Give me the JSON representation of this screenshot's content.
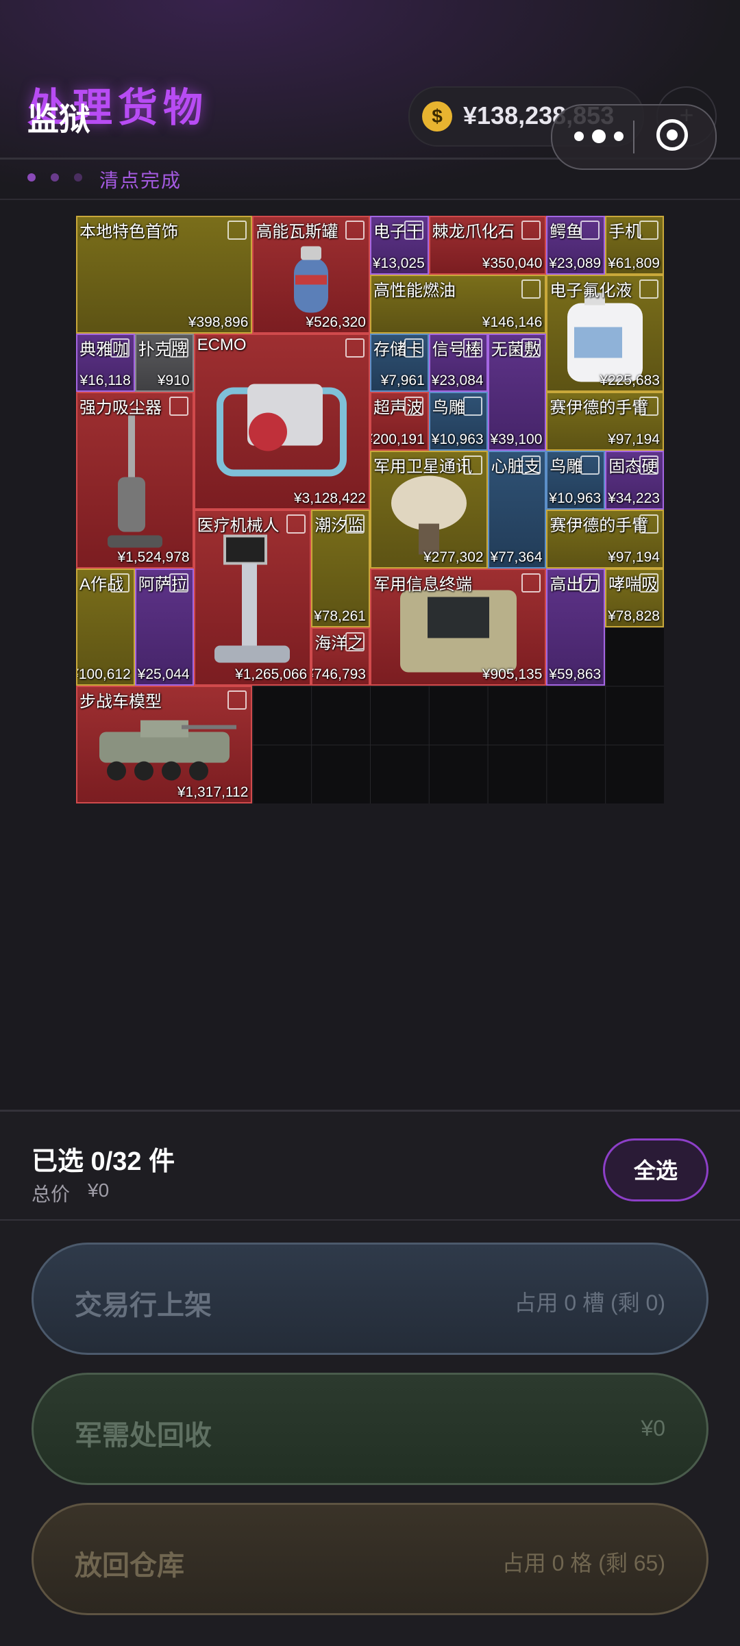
{
  "header": {
    "title": "处理货物",
    "overlay_title": "监狱",
    "currency_symbol": "$",
    "balance": "¥138,238,853",
    "plus": "+",
    "status": "清点完成"
  },
  "colors": {
    "accent": "#b84cf4",
    "rarity_red": "#9e2f31",
    "rarity_gold": "#7a6e1a",
    "rarity_purple": "#5e3389",
    "rarity_blue": "#2f5275",
    "rarity_gray": "#5b5b5e"
  },
  "inventory": {
    "columns": 10,
    "rows": 10,
    "items": [
      {
        "name": "本地特色首饰",
        "price": "¥398,896",
        "rarity": "gold",
        "icon": "jewelry-icon"
      },
      {
        "name": "高能瓦斯罐",
        "price": "¥526,320",
        "rarity": "red",
        "icon": "gas-tank-icon"
      },
      {
        "name": "电子干",
        "price": "¥13,025",
        "rarity": "purple",
        "icon": "electronics-icon"
      },
      {
        "name": "棘龙爪化石",
        "price": "¥350,040",
        "rarity": "red",
        "icon": "fossil-icon"
      },
      {
        "name": "鳄鱼",
        "price": "¥23,089",
        "rarity": "purple",
        "icon": "crocodile-icon"
      },
      {
        "name": "手机",
        "price": "¥61,809",
        "rarity": "gold",
        "icon": "phone-icon"
      },
      {
        "name": "高性能燃油",
        "price": "¥146,146",
        "rarity": "gold",
        "icon": "fuel-icon"
      },
      {
        "name": "电子氟化液",
        "price": "¥225,683",
        "rarity": "gold",
        "icon": "jug-icon"
      },
      {
        "name": "典雅咖",
        "price": "¥16,118",
        "rarity": "purple",
        "icon": "coffee-icon"
      },
      {
        "name": "扑克牌",
        "price": "¥910",
        "rarity": "gray",
        "icon": "cards-icon"
      },
      {
        "name": "ECMO",
        "price": "¥3,128,422",
        "rarity": "red",
        "icon": "ecmo-icon"
      },
      {
        "name": "存储卡",
        "price": "¥7,961",
        "rarity": "blue",
        "icon": "memory-card-icon"
      },
      {
        "name": "信号棒",
        "price": "¥23,084",
        "rarity": "purple",
        "icon": "signal-stick-icon"
      },
      {
        "name": "无菌敷",
        "price": "¥39,100",
        "rarity": "purple",
        "icon": "dressing-icon"
      },
      {
        "name": "强力吸尘器",
        "price": "¥1,524,978",
        "rarity": "red",
        "icon": "vacuum-icon"
      },
      {
        "name": "超声波",
        "price": "¥200,191",
        "rarity": "red",
        "icon": "ultrasound-icon"
      },
      {
        "name": "鸟雕",
        "price": "¥10,963",
        "rarity": "blue",
        "icon": "bird-statue-icon"
      },
      {
        "name": "赛伊德的手臂",
        "price": "¥97,194",
        "rarity": "gold",
        "icon": "watch-icon"
      },
      {
        "name": "军用卫星通讯",
        "price": "¥277,302",
        "rarity": "gold",
        "icon": "satellite-icon"
      },
      {
        "name": "心脏支",
        "price": "¥77,364",
        "rarity": "blue",
        "icon": "stent-icon"
      },
      {
        "name": "鸟雕",
        "price": "¥10,963",
        "rarity": "blue",
        "icon": "bird-statue-icon"
      },
      {
        "name": "固态硬",
        "price": "¥34,223",
        "rarity": "purple",
        "icon": "ssd-icon"
      },
      {
        "name": "医疗机械人",
        "price": "¥1,265,066",
        "rarity": "red",
        "icon": "medical-robot-icon"
      },
      {
        "name": "潮汐监",
        "price": "¥78,261",
        "rarity": "gold",
        "icon": "tide-monitor-icon"
      },
      {
        "name": "赛伊德的手臂",
        "price": "¥97,194",
        "rarity": "gold",
        "icon": "watch-icon"
      },
      {
        "name": "A作战",
        "price": "¥100,612",
        "rarity": "gold",
        "icon": "book-icon"
      },
      {
        "name": "阿萨拉",
        "price": "¥25,044",
        "rarity": "purple",
        "icon": "vase-icon"
      },
      {
        "name": "军用信息终端",
        "price": "¥905,135",
        "rarity": "red",
        "icon": "terminal-icon"
      },
      {
        "name": "高出力",
        "price": "¥59,863",
        "rarity": "purple",
        "icon": "tool-icon"
      },
      {
        "name": "哮喘吸",
        "price": "¥78,828",
        "rarity": "gold",
        "icon": "inhaler-icon"
      },
      {
        "name": "海洋之",
        "price": "¥746,793",
        "rarity": "red",
        "icon": "ocean-gem-icon"
      },
      {
        "name": "步战车模型",
        "price": "¥1,317,112",
        "rarity": "red",
        "icon": "tank-model-icon"
      }
    ]
  },
  "selection": {
    "count_text": "已选 0/32 件",
    "total_label": "总价",
    "total_value": "¥0",
    "select_all": "全选"
  },
  "actions": {
    "trade": {
      "label": "交易行上架",
      "info": "占用 0 槽 (剩 0)"
    },
    "recycle": {
      "label": "军需处回收",
      "info": "¥0"
    },
    "return": {
      "label": "放回仓库",
      "info": "占用 0 格 (剩 65)"
    }
  }
}
